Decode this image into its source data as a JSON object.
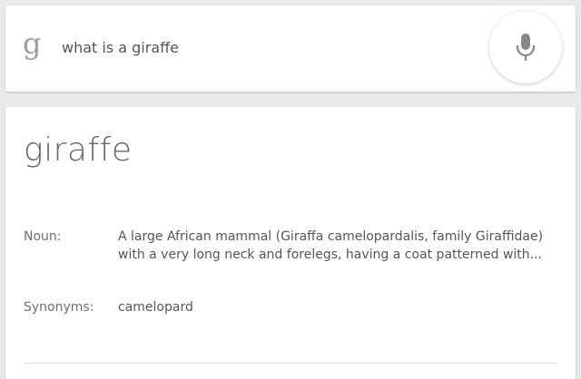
{
  "search": {
    "logo_letter": "g",
    "query": "what is a giraffe",
    "mic_icon": "microphone-icon"
  },
  "result": {
    "word": "giraffe",
    "noun_label": "Noun:",
    "noun_definition": "A large African mammal (Giraffa camelopardalis, family Giraffidae) with a very long neck and forelegs, having a coat patterned with...",
    "synonyms_label": "Synonyms:",
    "synonyms_value": "camelopard"
  },
  "colors": {
    "background": "#e9e9e9",
    "card": "#ffffff",
    "text": "#555555",
    "logo": "#9e9e9e",
    "icon": "#888888"
  }
}
